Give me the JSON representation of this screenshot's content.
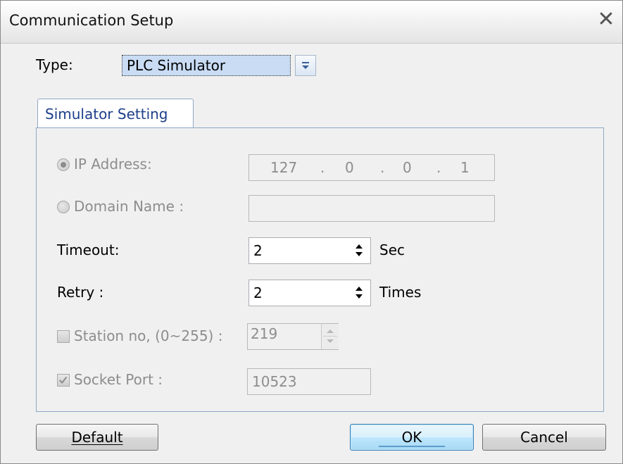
{
  "window": {
    "title": "Communication Setup",
    "close_glyph": "✕"
  },
  "type_row": {
    "label": "Type:",
    "selected": "PLC Simulator"
  },
  "tabs": [
    {
      "label": "Simulator Setting"
    }
  ],
  "settings": {
    "ip_address": {
      "label": "IP Address:",
      "octets": [
        "127",
        "0",
        "0",
        "1"
      ],
      "separator": ".",
      "selected": true
    },
    "domain_name": {
      "label": "Domain Name :",
      "value": "",
      "selected": false
    },
    "timeout": {
      "label": "Timeout:",
      "value": "2",
      "unit": "Sec"
    },
    "retry": {
      "label": "Retry :",
      "value": "2",
      "unit": "Times"
    },
    "station_no": {
      "label": "Station no, (0~255) :",
      "value": "219",
      "checked": false
    },
    "socket_port": {
      "label": "Socket Port :",
      "value": "10523",
      "checked": true
    }
  },
  "buttons": {
    "default_label": "Default",
    "ok_label": "OK",
    "cancel_label": "Cancel"
  }
}
